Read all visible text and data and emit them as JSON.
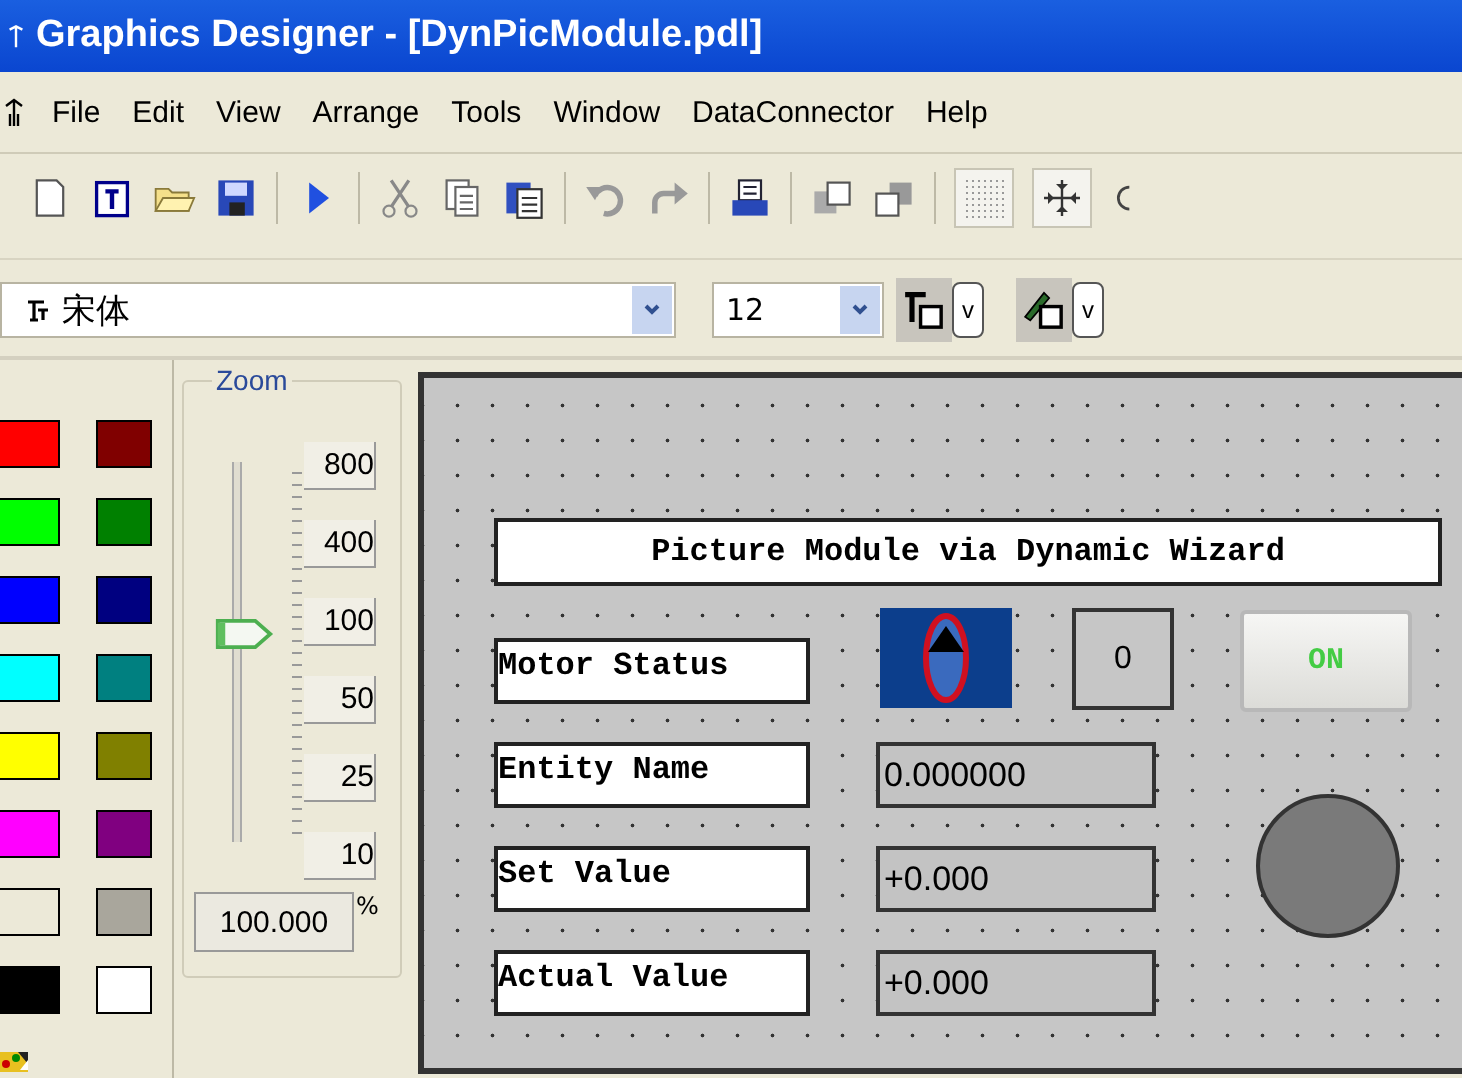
{
  "window": {
    "title": "Graphics Designer - [DynPicModule.pdl]"
  },
  "menu": [
    "File",
    "Edit",
    "View",
    "Arrange",
    "Tools",
    "Window",
    "DataConnector",
    "Help"
  ],
  "font_bar": {
    "font": "宋体",
    "size": "12",
    "text_color_dropdown": "v",
    "line_color_dropdown": "v"
  },
  "palette": [
    {
      "color": "#ff0000"
    },
    {
      "color": "#800000"
    },
    {
      "color": "#00ff00"
    },
    {
      "color": "#008000"
    },
    {
      "color": "#0000ff"
    },
    {
      "color": "#000080"
    },
    {
      "color": "#00ffff"
    },
    {
      "color": "#008080"
    },
    {
      "color": "#ffff00"
    },
    {
      "color": "#808000"
    },
    {
      "color": "#ff00ff"
    },
    {
      "color": "#800080"
    },
    {
      "color": "#ece9d8"
    },
    {
      "color": "#a9a69c"
    },
    {
      "color": "#000000"
    },
    {
      "color": "#ffffff"
    }
  ],
  "zoom": {
    "title": "Zoom",
    "presets": [
      "800",
      "400",
      "100",
      "50",
      "25",
      "10"
    ],
    "level": 0.55,
    "value": "100.000",
    "unit": "%"
  },
  "canvas": {
    "title": "Picture Module via Dynamic Wizard",
    "status_value": "0",
    "button": "ON",
    "rows": [
      {
        "label": "Motor Status"
      },
      {
        "label": "Entity Name",
        "value": "0.000000"
      },
      {
        "label": "Set Value",
        "value": "+0.000"
      },
      {
        "label": "Actual Value",
        "value": "+0.000"
      }
    ]
  }
}
